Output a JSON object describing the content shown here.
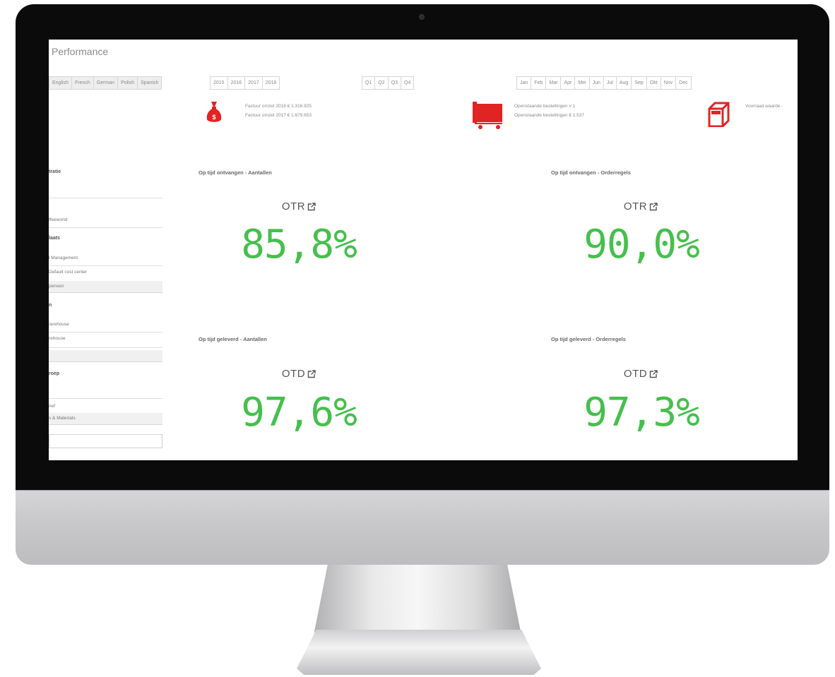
{
  "app": {
    "title": "Performance"
  },
  "filters": {
    "languages": [
      "English",
      "French",
      "German",
      "Polish",
      "Spanish"
    ],
    "years": [
      "2015",
      "2016",
      "2017",
      "2018"
    ],
    "quarters": [
      "Q1",
      "Q2",
      "Q3",
      "Q4"
    ],
    "months": [
      "Jan",
      "Feb",
      "Mar",
      "Apr",
      "Mei",
      "Jun",
      "Jul",
      "Aug",
      "Sep",
      "Okt",
      "Nov",
      "Dec"
    ]
  },
  "kpis": {
    "revenue": {
      "line1": "Factuur omzet 2018 € 1.316.925",
      "line2": "Factuur omzet 2017 € 1.679.653"
    },
    "orders": {
      "line1": "Openstaande bestellingen # 1",
      "line2": "Openstaande bestellingen € 1.537"
    },
    "stock": {
      "line1": "Voorraad waarde -"
    }
  },
  "sidebar": {
    "head1": "tratie",
    "item1": "ffeeworld",
    "head2": "laats",
    "item2": "l Management",
    "item3": "Default cost center",
    "item4": "pensen",
    "head3": "n",
    "item5": "/arehouse",
    "item6": "rehouse",
    "head4": "roep",
    "item7": "rief",
    "item8": "s & Materials"
  },
  "panels": [
    {
      "title": "Op tijd ontvangen - Aantallen",
      "label": "OTR",
      "value": "85,8%"
    },
    {
      "title": "Op tijd ontvangen - Orderregels",
      "label": "OTR",
      "value": "90,0%"
    },
    {
      "title": "Op tijd geleverd - Aantallen",
      "label": "OTD",
      "value": "97,6%"
    },
    {
      "title": "Op tijd geleverd - Orderregels",
      "label": "OTD",
      "value": "97,3%"
    }
  ],
  "colors": {
    "kpi_value": "#46bf4d",
    "icon_red": "#e02424"
  }
}
